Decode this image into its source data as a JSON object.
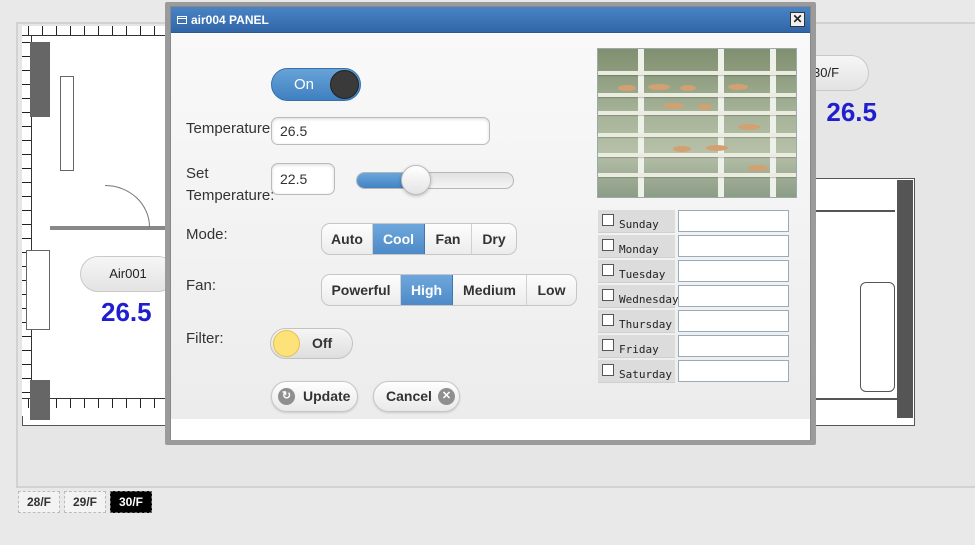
{
  "dialog": {
    "title": "air004 PANEL",
    "close_symbol": "✕"
  },
  "power": {
    "label": "On",
    "state": true
  },
  "temperature": {
    "label": "Temperature",
    "value": "26.5"
  },
  "set_temperature": {
    "label_line1": "Set",
    "label_line2": "Temperature:",
    "value": "22.5",
    "slider_fraction": 0.38
  },
  "mode": {
    "label": "Mode:",
    "options": [
      "Auto",
      "Cool",
      "Fan",
      "Dry"
    ],
    "selected": "Cool"
  },
  "fan": {
    "label": "Fan:",
    "options": [
      "Powerful",
      "High",
      "Medium",
      "Low"
    ],
    "selected": "High"
  },
  "filter": {
    "label": "Filter:",
    "toggle_label": "Off",
    "state": false
  },
  "buttons": {
    "update_label": "Update",
    "update_icon": "refresh-icon",
    "cancel_label": "Cancel",
    "cancel_icon": "close-circle-icon"
  },
  "schedule": {
    "days": [
      "Sunday",
      "Monday",
      "Tuesday",
      "Wednesday",
      "Thursday",
      "Friday",
      "Saturday"
    ]
  },
  "background": {
    "ac_left": {
      "name": "Air001",
      "temp": "26.5"
    },
    "ac_right": {
      "name": "30/F",
      "temp": "26.5"
    },
    "floor_tabs": [
      "28/F",
      "29/F",
      "30/F"
    ],
    "active_floor": "30/F"
  },
  "colors": {
    "titlebar": "#3a72b4",
    "accent": "#4d8ac8",
    "temp_text": "#1f1fd0",
    "filter_knob": "#fde27a"
  }
}
